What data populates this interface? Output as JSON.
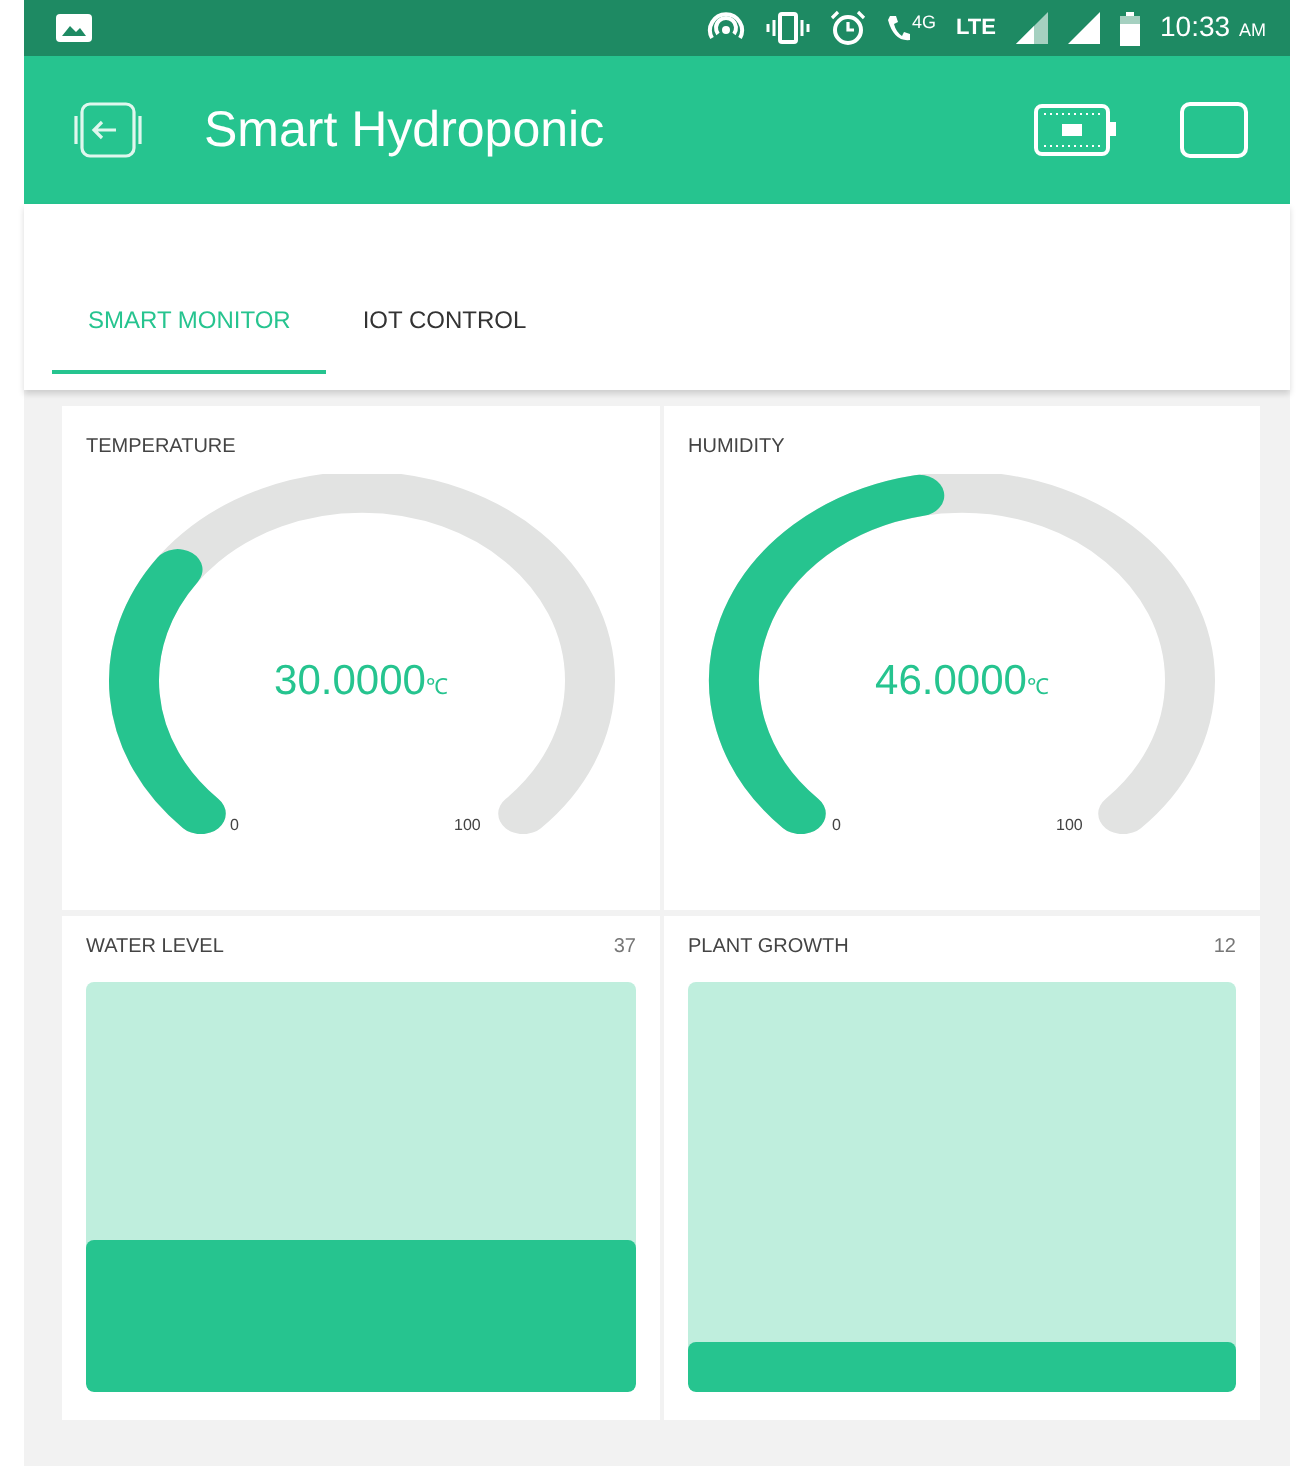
{
  "status_bar": {
    "time": "10:33",
    "ampm": "AM",
    "network": "4G",
    "lte": "LTE"
  },
  "app_bar": {
    "title": "Smart Hydroponic"
  },
  "tabs": [
    {
      "label": "SMART MONITOR",
      "selected": true
    },
    {
      "label": "IOT CONTROL",
      "selected": false
    }
  ],
  "gauges": [
    {
      "label": "TEMPERATURE",
      "value": "30.0000",
      "unit": "℃",
      "min": "0",
      "max": "100"
    },
    {
      "label": "HUMIDITY",
      "value": "46.0000",
      "unit": "℃",
      "min": "0",
      "max": "100"
    }
  ],
  "tanks": [
    {
      "label": "WATER LEVEL",
      "reading": "37"
    },
    {
      "label": "PLANT GROWTH",
      "reading": "12"
    }
  ]
}
